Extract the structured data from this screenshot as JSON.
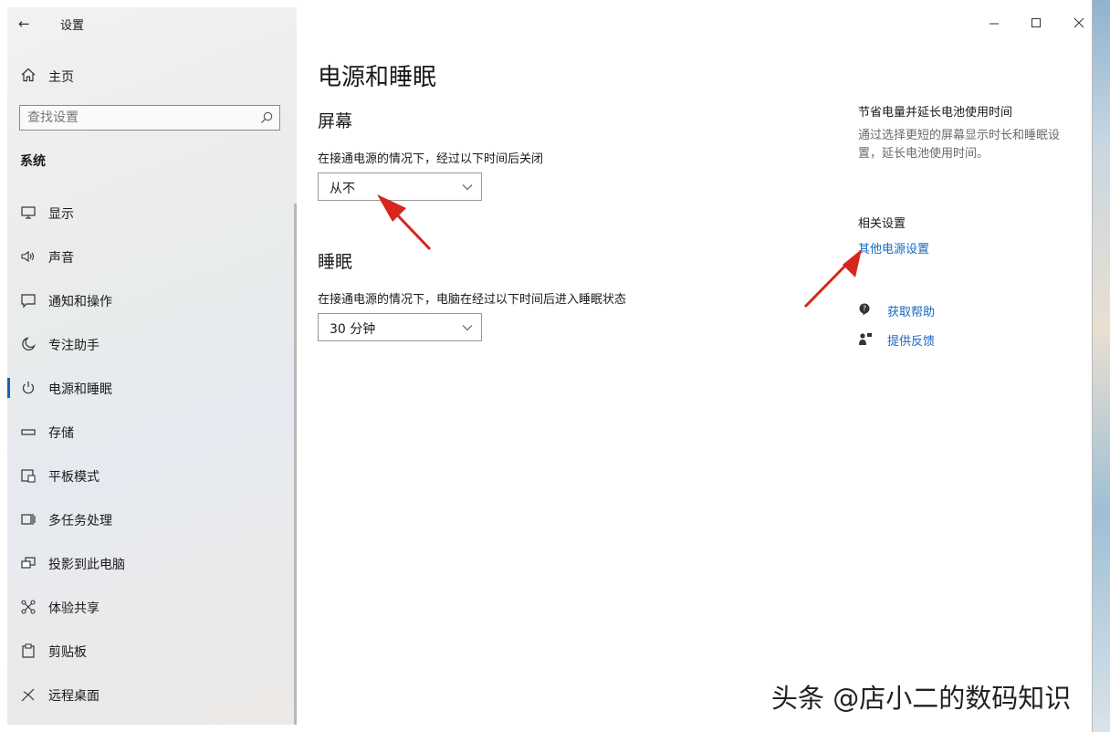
{
  "window": {
    "back_glyph": "←",
    "title": "设置"
  },
  "sidebar": {
    "home_label": "主页",
    "search_placeholder": "查找设置",
    "section_title": "系统",
    "items": [
      {
        "label": "显示",
        "icon": "monitor-icon",
        "active": false
      },
      {
        "label": "声音",
        "icon": "speaker-icon",
        "active": false
      },
      {
        "label": "通知和操作",
        "icon": "notification-icon",
        "active": false
      },
      {
        "label": "专注助手",
        "icon": "moon-icon",
        "active": false
      },
      {
        "label": "电源和睡眠",
        "icon": "power-icon",
        "active": true
      },
      {
        "label": "存储",
        "icon": "storage-icon",
        "active": false
      },
      {
        "label": "平板模式",
        "icon": "tablet-icon",
        "active": false
      },
      {
        "label": "多任务处理",
        "icon": "multitask-icon",
        "active": false
      },
      {
        "label": "投影到此电脑",
        "icon": "projection-icon",
        "active": false
      },
      {
        "label": "体验共享",
        "icon": "share-icon",
        "active": false
      },
      {
        "label": "剪贴板",
        "icon": "clipboard-icon",
        "active": false
      },
      {
        "label": "远程桌面",
        "icon": "remote-desktop-icon",
        "active": false
      }
    ]
  },
  "main": {
    "page_title": "电源和睡眠",
    "screen": {
      "heading": "屏幕",
      "description": "在接通电源的情况下，经过以下时间后关闭",
      "selected": "从不"
    },
    "sleep": {
      "heading": "睡眠",
      "description": "在接通电源的情况下，电脑在经过以下时间后进入睡眠状态",
      "selected": "30 分钟"
    }
  },
  "right": {
    "tip_title": "节省电量并延长电池使用时间",
    "tip_text": "通过选择更短的屏幕显示时长和睡眠设置，延长电池使用时间。",
    "related_title": "相关设置",
    "related_link": "其他电源设置",
    "help_label": "获取帮助",
    "feedback_label": "提供反馈"
  },
  "watermark": "头条 @店小二的数码知识",
  "colors": {
    "accent": "#1767c0",
    "active_bar": "#1a5fb4",
    "annotation_arrow": "#d6261e"
  }
}
